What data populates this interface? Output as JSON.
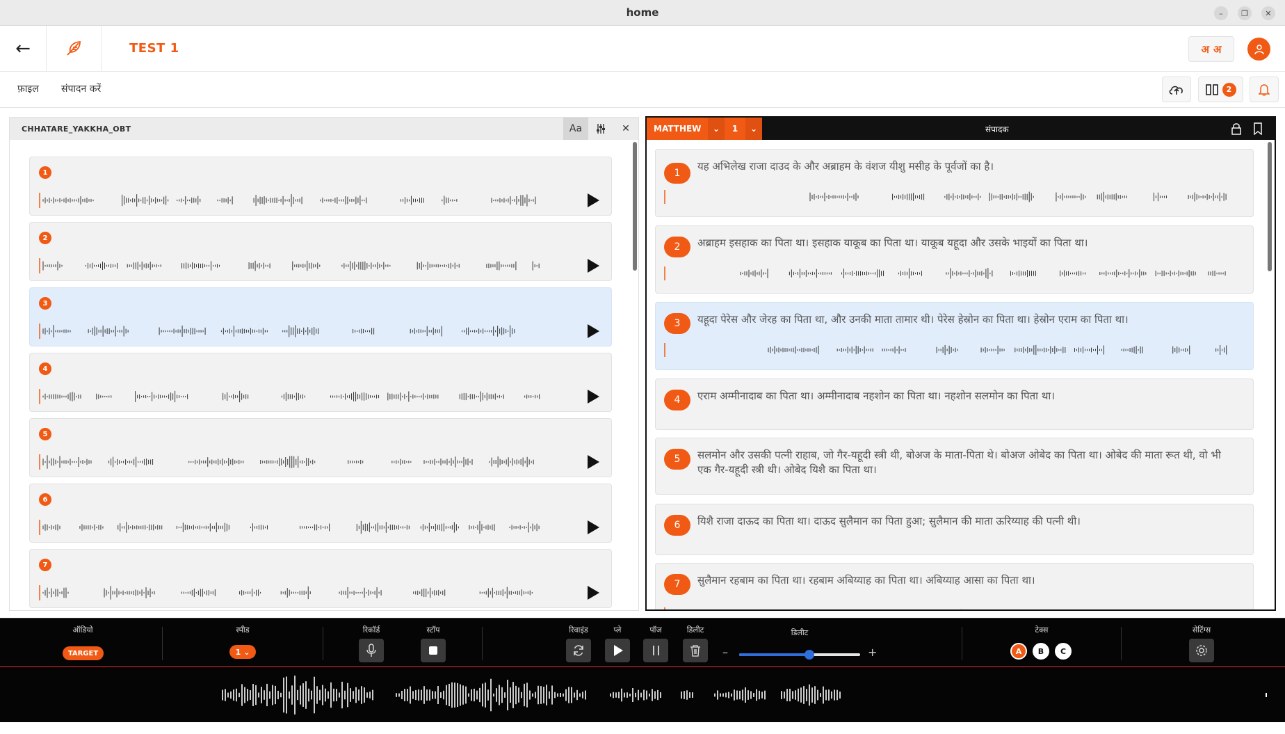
{
  "window": {
    "title": "home"
  },
  "app": {
    "project_title": "TEST 1",
    "font_toggle_a": "अ",
    "font_toggle_b": "अ"
  },
  "menu": {
    "file": "फ़ाइल",
    "edit": "संपादन करें"
  },
  "toolbar": {
    "panels_count": "2"
  },
  "left_panel": {
    "title": "CHHATARE_YAKKHA_OBT",
    "font_tool": "Aa",
    "items": [
      {
        "num": "1"
      },
      {
        "num": "2"
      },
      {
        "num": "3"
      },
      {
        "num": "4"
      },
      {
        "num": "5"
      },
      {
        "num": "6"
      },
      {
        "num": "7"
      }
    ],
    "active_index": 3
  },
  "right_panel": {
    "book": "MATTHEW",
    "chapter": "1",
    "mode": "संपादक",
    "verses": [
      {
        "num": "1",
        "text": "यह अभिलेख राजा दाउद के और अब्राहम के वंशज यीशु मसीह के पूर्वजों का है।"
      },
      {
        "num": "2",
        "text": "अब्राहम इसहाक का पिता था। इसहाक याकूब का पिता था। याकूब यहूदा और उसके भाइयों का पिता था।"
      },
      {
        "num": "3",
        "text": "यहूदा पेरेस और जेरह का पिता था, और उनकी माता तामार थी। पेरेस हेस्रोन का पिता था। हेस्रोन एराम का पिता था।"
      },
      {
        "num": "4",
        "text": "एराम अम्मीनादाब का पिता था। अम्मीनादाब नहशोन का पिता था। नहशोन सलमोन का पिता था।"
      },
      {
        "num": "5",
        "text": "सलमोन और उसकी पत्नी राहाब, जो गैर-यहूदी स्त्री थी, बोअज के माता-पिता थे। बोअज ओबेद का पिता था। ओबेद की माता रूत थी, वो भी एक गैर-यहूदी स्त्री थी। ओबेद यिशै का पिता था।"
      },
      {
        "num": "6",
        "text": "यिशै राजा दाऊद का पिता था। दाऊद सुलैमान का पिता हुआ; सुलैमान की माता ऊरिय्याह की पत्नी थी।"
      },
      {
        "num": "7",
        "text": "सुलैमान रहबाम का पिता था। रहबाम अबिय्याह का पिता था। अबिय्याह आसा का पिता था।"
      }
    ],
    "active_index": 3
  },
  "bottom": {
    "audio_label": "ऑडियो",
    "target": "TARGET",
    "speed_label": "स्पीड",
    "speed_value": "1",
    "record_label": "रिकॉर्ड",
    "stop_label": "स्टॉप",
    "rewind_label": "रिवाइंड",
    "play_label": "प्ले",
    "pause_label": "पॉज",
    "delete_label": "डिलीट",
    "slider_label": "डिलीट",
    "slider_minus": "–",
    "slider_plus": "+",
    "slider_value": 0.58,
    "takes_label": "टेक्स",
    "takes": [
      "A",
      "B",
      "C"
    ],
    "active_take": "A",
    "settings_label": "सेटिंग्स"
  },
  "colors": {
    "accent": "#f05a14",
    "active_card": "#e1edfb",
    "card": "#f2f2f3",
    "dark": "#050505"
  }
}
